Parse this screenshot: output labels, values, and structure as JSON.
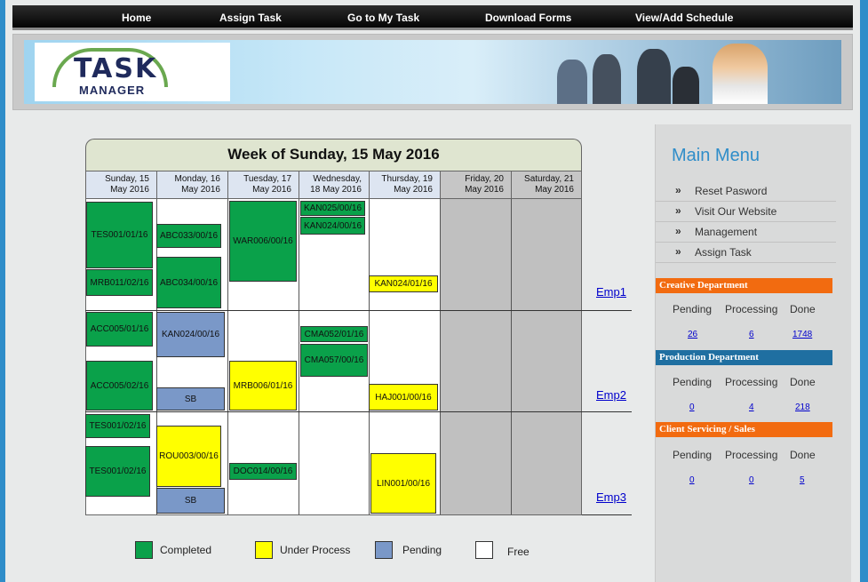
{
  "nav": [
    "Home",
    "Assign Task",
    "Go to My Task",
    "Download Forms",
    "View/Add Schedule"
  ],
  "logo": {
    "line1": "TASK",
    "line2": "MANAGER"
  },
  "calendar": {
    "title": "Week of Sunday, 15 May 2016",
    "days": [
      {
        "line1": "Sunday, 15",
        "line2": "May 2016"
      },
      {
        "line1": "Monday, 16",
        "line2": "May 2016"
      },
      {
        "line1": "Tuesday, 17",
        "line2": "May 2016"
      },
      {
        "line1": "Wednesday,",
        "line2": "18 May 2016"
      },
      {
        "line1": "Thursday, 19",
        "line2": "May 2016"
      },
      {
        "line1": "Friday, 20",
        "line2": "May 2016"
      },
      {
        "line1": "Saturday, 21",
        "line2": "May 2016"
      }
    ],
    "employees": [
      "Emp1",
      "Emp2",
      "Emp3"
    ],
    "tasks": [
      {
        "label": "TES001/01/16",
        "status": "completed"
      },
      {
        "label": "MRB011/02/16",
        "status": "completed"
      },
      {
        "label": "ABC033/00/16",
        "status": "completed"
      },
      {
        "label": "ABC034/00/16",
        "status": "completed"
      },
      {
        "label": "WAR006/00/16",
        "status": "completed"
      },
      {
        "label": "KAN025/00/16",
        "status": "completed"
      },
      {
        "label": "KAN024/00/16",
        "status": "completed"
      },
      {
        "label": "KAN024/01/16",
        "status": "under-process"
      },
      {
        "label": "ACC005/01/16",
        "status": "completed"
      },
      {
        "label": "ACC005/02/16",
        "status": "completed"
      },
      {
        "label": "KAN024/00/16",
        "status": "pending"
      },
      {
        "label": "SB",
        "status": "pending"
      },
      {
        "label": "MRB006/01/16",
        "status": "under-process"
      },
      {
        "label": "CMA052/01/16",
        "status": "completed"
      },
      {
        "label": "CMA057/00/16",
        "status": "completed"
      },
      {
        "label": "HAJ001/00/16",
        "status": "under-process"
      },
      {
        "label": "TES001/02/16",
        "status": "completed"
      },
      {
        "label": "TES001/02/16",
        "status": "completed"
      },
      {
        "label": "ROU003/00/16",
        "status": "under-process"
      },
      {
        "label": "SB",
        "status": "pending"
      },
      {
        "label": "DOC014/00/16",
        "status": "completed"
      },
      {
        "label": "LIN001/00/16",
        "status": "under-process"
      }
    ]
  },
  "legend": [
    {
      "label": "Completed",
      "color": "#0aa14a"
    },
    {
      "label": "Under Process",
      "color": "#ffff00"
    },
    {
      "label": "Pending",
      "color": "#7a98c8"
    },
    {
      "label": "Free",
      "color": "#ffffff"
    }
  ],
  "menu": {
    "title": "Main Menu",
    "items": [
      "Reset Pasword",
      "Visit Our Website",
      "Management",
      "Assign Task"
    ]
  },
  "departments": [
    {
      "name": "Creative Department",
      "color": "#f26b10",
      "headers": [
        "Pending",
        "Processing",
        "Done"
      ],
      "values": [
        "26",
        "6",
        "1748"
      ]
    },
    {
      "name": "Production Department",
      "color": "#1f6fa1",
      "headers": [
        "Pending",
        "Processing",
        "Done"
      ],
      "values": [
        "0",
        "4",
        "218"
      ]
    },
    {
      "name": "Client Servicing / Sales",
      "color": "#f26b10",
      "headers": [
        "Pending",
        "Processing",
        "Done"
      ],
      "values": [
        "0",
        "0",
        "5"
      ]
    }
  ],
  "colors": {
    "accent": "#2f8dc9",
    "completed": "#0aa14a",
    "under_process": "#ffff00",
    "pending": "#7a98c8",
    "weekend": "#c0c0c0"
  }
}
